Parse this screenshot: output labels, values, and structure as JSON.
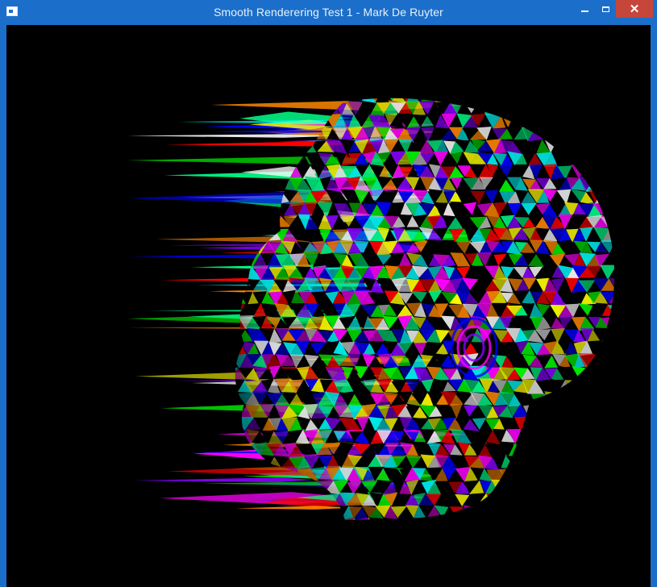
{
  "window": {
    "title": "Smooth Renderering Test 1 - Mark De Ruyter",
    "icon": "app-window-icon",
    "controls": {
      "minimize_icon": "minimize-icon",
      "maximize_icon": "maximize-icon",
      "close_icon": "close-icon"
    }
  },
  "viewport": {
    "background": "#000000",
    "content": "rendered-3d-head-mesh",
    "palette": [
      "#ff00ff",
      "#00ffff",
      "#ffff00",
      "#ff0000",
      "#00ff00",
      "#0000ff",
      "#ffffff",
      "#ff8800",
      "#8800ff",
      "#00ff88"
    ]
  }
}
